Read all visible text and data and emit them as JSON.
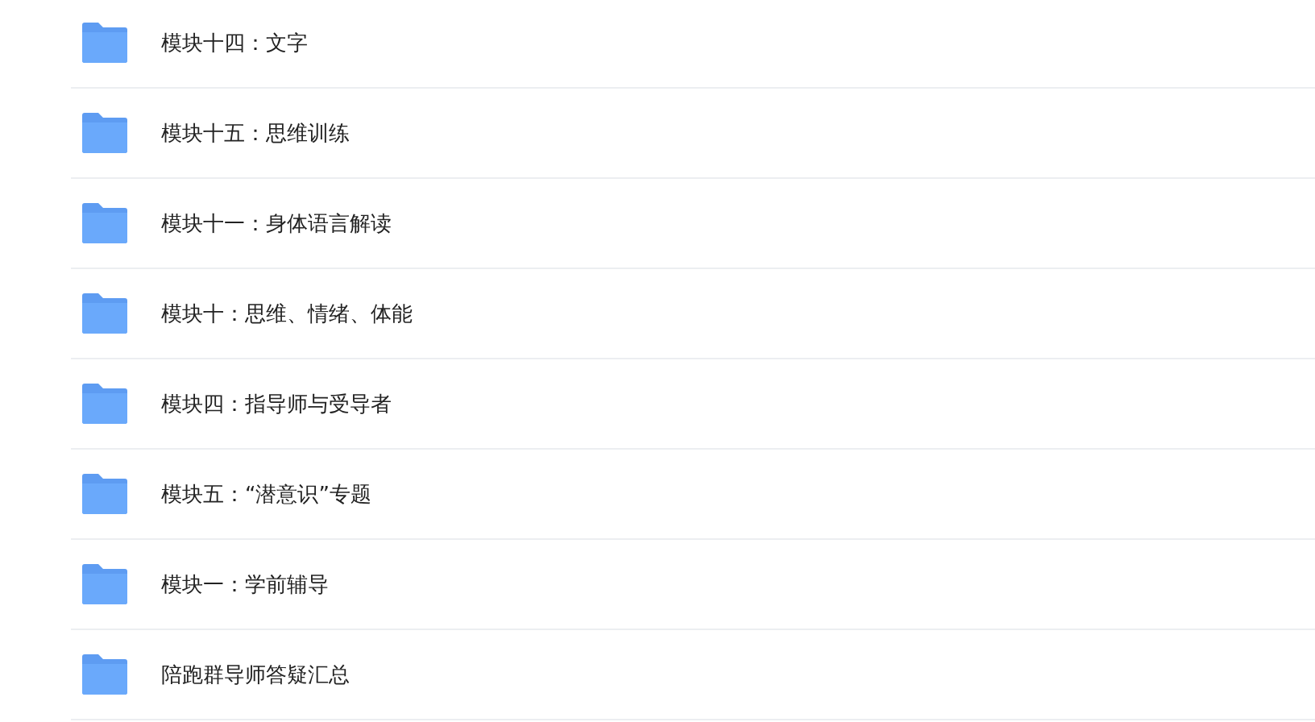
{
  "folders": [
    {
      "name": "模块十四：文字"
    },
    {
      "name": "模块十五：思维训练"
    },
    {
      "name": "模块十一：身体语言解读"
    },
    {
      "name": "模块十：思维、情绪、体能"
    },
    {
      "name": "模块四：指导师与受导者"
    },
    {
      "name": "模块五：“潜意识”专题"
    },
    {
      "name": "模块一：学前辅导"
    },
    {
      "name": "陪跑群导师答疑汇总"
    }
  ]
}
